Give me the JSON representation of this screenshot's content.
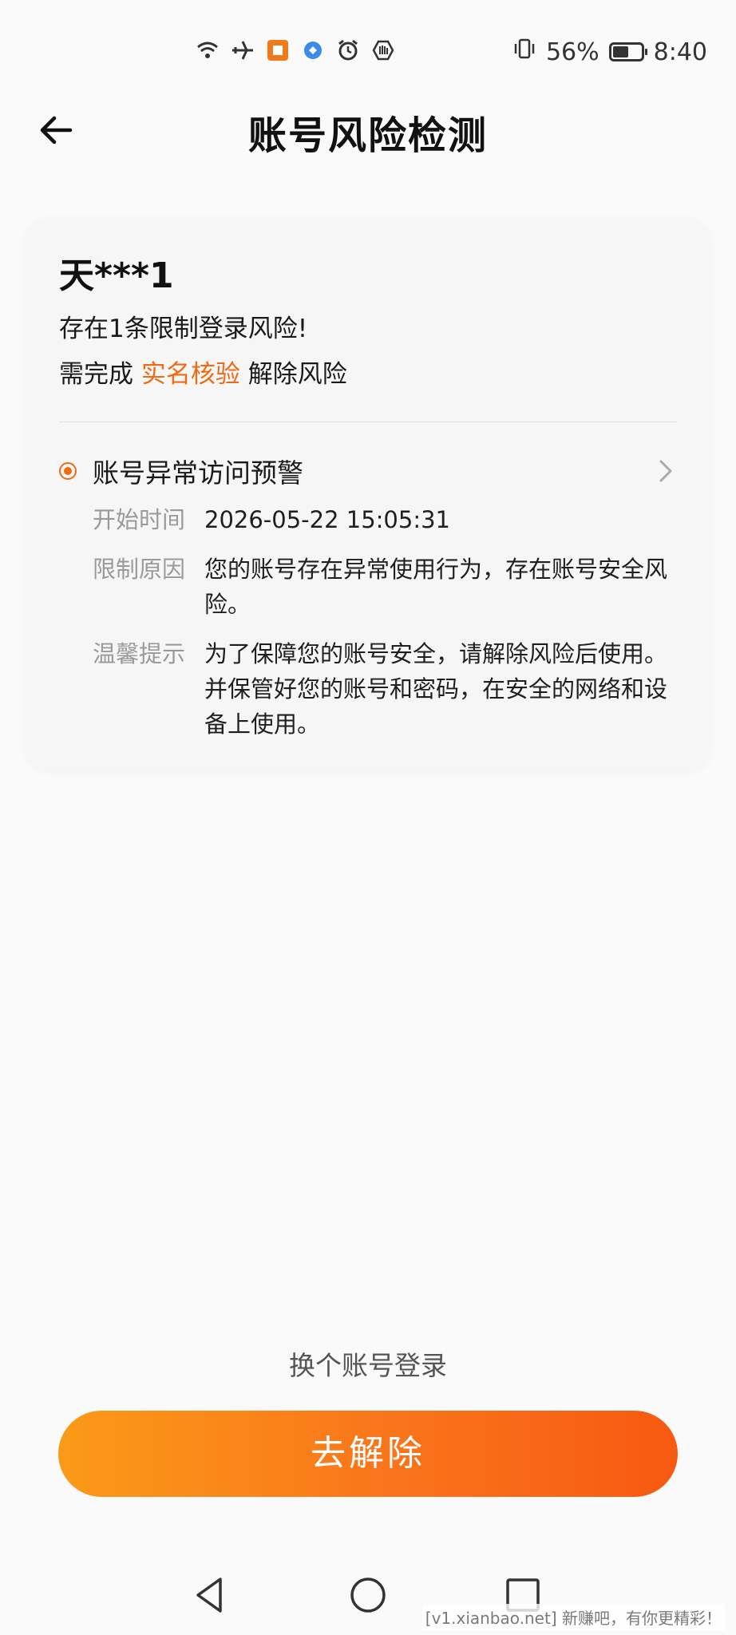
{
  "status_bar": {
    "battery_percent": "56%",
    "battery_level": 0.56,
    "time": "8:40",
    "icons": [
      "wifi-icon",
      "airplane-icon",
      "app-notification-icon",
      "app-bubble-icon",
      "alarm-icon",
      "hand-icon",
      "vibrate-icon"
    ]
  },
  "header": {
    "title": "账号风险检测"
  },
  "card": {
    "account_name": "天***1",
    "risk_summary": "存在1条限制登录风险!",
    "action_prefix": "需完成 ",
    "action_highlight": "实名核验",
    "action_suffix": " 解除风险",
    "risk_item": {
      "title": "账号异常访问预警",
      "start_time_label": "开始时间",
      "start_time_value": "2026-05-22 15:05:31",
      "reason_label": "限制原因",
      "reason_value": "您的账号存在异常使用行为，存在账号安全风险。",
      "tip_label": "温馨提示",
      "tip_value": "为了保障您的账号安全，请解除风险后使用。并保管好您的账号和密码，在安全的网络和设备上使用。"
    }
  },
  "switch_account_label": "换个账号登录",
  "primary_button_label": "去解除",
  "watermark": "[v1.xianbao.net] 新赚吧，有你更精彩！",
  "colors": {
    "accent": "#ef6a12",
    "button_gradient_start": "#fb9a18",
    "button_gradient_end": "#f85912"
  }
}
